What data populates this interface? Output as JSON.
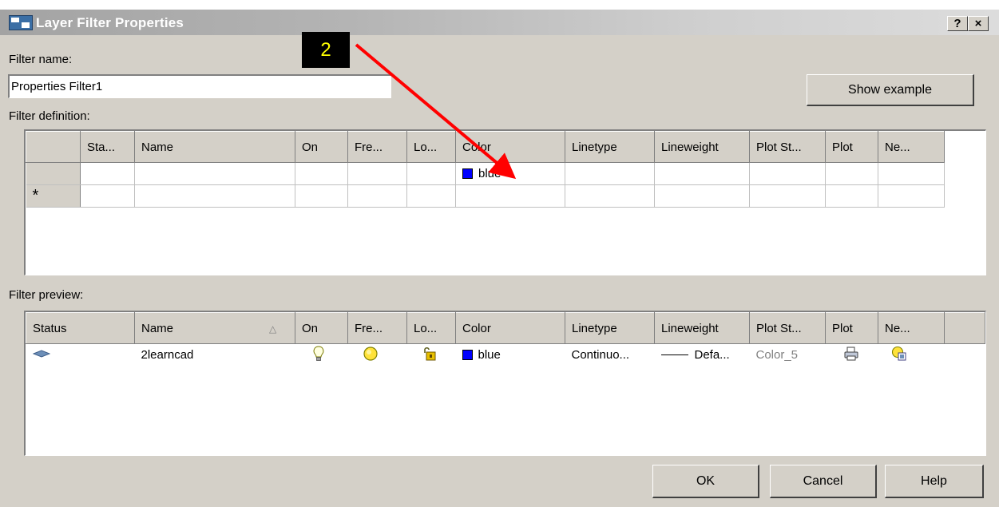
{
  "window": {
    "title": "Layer Filter Properties",
    "help_button": "?",
    "close_button": "×"
  },
  "filter_name": {
    "label": "Filter name:",
    "value": "Properties Filter1"
  },
  "show_example_button": "Show example",
  "filter_definition": {
    "label": "Filter definition:",
    "columns": [
      "Sta...",
      "Name",
      "On",
      "Fre...",
      "Lo...",
      "Color",
      "Linetype",
      "Lineweight",
      "Plot St...",
      "Plot",
      "Ne..."
    ],
    "rows": [
      {
        "marker": "",
        "color": "blue"
      },
      {
        "marker": "*",
        "color": ""
      }
    ]
  },
  "filter_preview": {
    "label": "Filter preview:",
    "columns": [
      "Status",
      "Name",
      "On",
      "Fre...",
      "Lo...",
      "Color",
      "Linetype",
      "Lineweight",
      "Plot St...",
      "Plot",
      "Ne..."
    ],
    "sort_glyph": "△",
    "rows": [
      {
        "name": "2learncad",
        "color": "blue",
        "linetype": "Continuo...",
        "lineweight": "Defa...",
        "plot_style": "Color_5"
      }
    ]
  },
  "annotation": {
    "step_number": "2",
    "arrow_color": "#ff0000"
  },
  "buttons": {
    "ok": "OK",
    "cancel": "Cancel",
    "help": "Help"
  },
  "colors": {
    "dialog_bg": "#d4d0c8",
    "swatch_blue": "#0000ff",
    "badge_bg": "#000000",
    "badge_text": "#ffff00"
  }
}
